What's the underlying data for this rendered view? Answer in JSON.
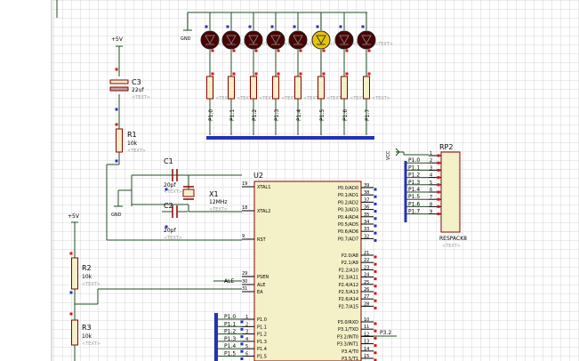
{
  "power": {
    "gnd_top": "GND",
    "vcc_c3": "+5V",
    "vcc_r2": "+5V",
    "gnd_xtal": "GND",
    "vcc_rp2": "VCC"
  },
  "leds": {
    "count": 8,
    "lit_index": 5,
    "text_placeholder": "<TEXT>"
  },
  "led_resistors": {
    "net_labels": [
      "P1.0",
      "P1.1",
      "P1.2",
      "P1.3",
      "P1.4",
      "P1.5",
      "P1.6",
      "P1.7"
    ],
    "text_placeholder": "<TEXT>"
  },
  "c3": {
    "ref": "C3",
    "value": "22uf",
    "text": "<TEXT>"
  },
  "r1": {
    "ref": "R1",
    "value": "10k",
    "text": "<TEXT>"
  },
  "c1": {
    "ref": "C1",
    "value": "20pf",
    "text": "<TEXT>"
  },
  "c2": {
    "ref": "C2",
    "value": "20pf",
    "text": "<TEXT>"
  },
  "x1": {
    "ref": "X1",
    "value": "12MHz",
    "text": "<TEXT>"
  },
  "r2": {
    "ref": "R2",
    "value": "10k",
    "text": "<TEXT>"
  },
  "r3": {
    "ref": "R3",
    "value": "10k",
    "text": "<TEXT>"
  },
  "rp2": {
    "ref": "RP2",
    "part": "RESPACK8",
    "text": "<TEXT>",
    "pins": [
      {
        "num": "1",
        "net": ""
      },
      {
        "num": "2",
        "net": "P1.0"
      },
      {
        "num": "3",
        "net": "P1.1"
      },
      {
        "num": "4",
        "net": "P1.2"
      },
      {
        "num": "5",
        "net": "P1.3"
      },
      {
        "num": "6",
        "net": "P1.4"
      },
      {
        "num": "7",
        "net": "P1.5"
      },
      {
        "num": "8",
        "net": "P1.6"
      },
      {
        "num": "9",
        "net": "P1.7"
      }
    ]
  },
  "u2": {
    "ref": "U2",
    "left_pins": [
      {
        "num": "19",
        "name": "XTAL1"
      },
      {
        "num": "18",
        "name": "XTAL2"
      },
      {
        "num": "9",
        "name": "RST"
      },
      {
        "num": "29",
        "name": "PSEN"
      },
      {
        "num": "30",
        "name": "ALE"
      },
      {
        "num": "31",
        "name": "EA"
      }
    ],
    "p1_pins": [
      {
        "num": "1",
        "name": "P1.0"
      },
      {
        "num": "2",
        "name": "P1.1"
      },
      {
        "num": "3",
        "name": "P1.2"
      },
      {
        "num": "4",
        "name": "P1.3"
      },
      {
        "num": "5",
        "name": "P1.4"
      },
      {
        "num": "6",
        "name": "P1.5"
      }
    ],
    "p0_pins": [
      {
        "num": "39",
        "name": "P0.0/AD0"
      },
      {
        "num": "38",
        "name": "P0.1/AD1"
      },
      {
        "num": "37",
        "name": "P0.2/AD2"
      },
      {
        "num": "36",
        "name": "P0.3/AD3"
      },
      {
        "num": "35",
        "name": "P0.4/AD4"
      },
      {
        "num": "34",
        "name": "P0.5/AD5"
      },
      {
        "num": "33",
        "name": "P0.6/AD6"
      },
      {
        "num": "32",
        "name": "P0.7/AD7"
      }
    ],
    "p2_pins": [
      {
        "num": "21",
        "name": "P2.0/A8"
      },
      {
        "num": "22",
        "name": "P2.1/A9"
      },
      {
        "num": "23",
        "name": "P2.2/A10"
      },
      {
        "num": "24",
        "name": "P2.3/A11"
      },
      {
        "num": "25",
        "name": "P2.4/A12"
      },
      {
        "num": "26",
        "name": "P2.5/A13"
      },
      {
        "num": "27",
        "name": "P2.6/A14"
      },
      {
        "num": "28",
        "name": "P2.7/A15"
      }
    ],
    "p3_pins": [
      {
        "num": "10",
        "name": "P3.0/RXD"
      },
      {
        "num": "11",
        "name": "P3.1/TXD"
      },
      {
        "num": "12",
        "name": "P3.2/INT0"
      },
      {
        "num": "13",
        "name": "P3.3/INT1"
      },
      {
        "num": "14",
        "name": "P3.4/T0"
      },
      {
        "num": "15",
        "name": "P3.5/T1"
      }
    ]
  },
  "nets": {
    "ale": "ALE",
    "p32": "P3.2",
    "left_bus_labels": [
      "P1.0",
      "P1.1",
      "P1.2",
      "P1.3",
      "P1.4",
      "P1.5"
    ]
  },
  "colors": {
    "wire": "#1f4d1f",
    "part_outline": "#8b0000",
    "part_fill": "#f4f0c8",
    "bus": "#2432b4",
    "led_red": "#4a0000",
    "led_lit": "#e8c400",
    "grid": "#d6d6d6"
  }
}
